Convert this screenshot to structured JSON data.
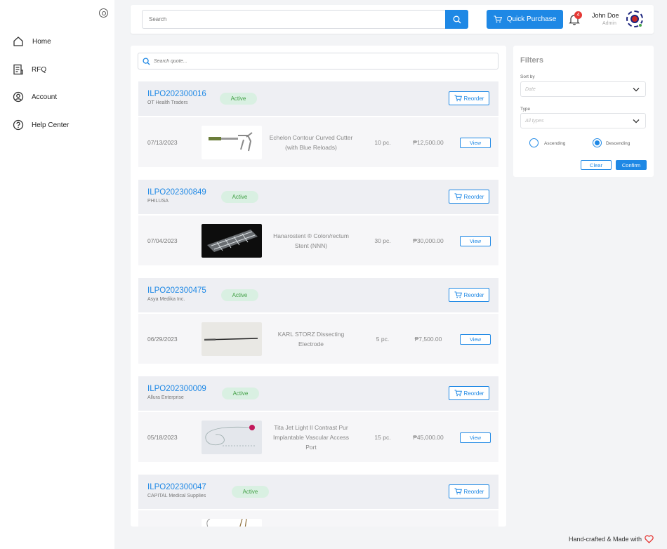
{
  "sidebar": {
    "items": [
      {
        "label": "Home",
        "icon": "home-icon"
      },
      {
        "label": "RFQ",
        "icon": "document-list-icon"
      },
      {
        "label": "Account",
        "icon": "user-circle-icon"
      },
      {
        "label": "Help Center",
        "icon": "help-circle-icon"
      }
    ]
  },
  "topbar": {
    "search_placeholder": "Search",
    "quick_purchase_label": "Quick Purchase",
    "notification_count": "4",
    "user_name": "John Doe",
    "user_role": "Admin"
  },
  "quotes": {
    "search_placeholder": "Search quote...",
    "reorder_label": "Reorder",
    "view_label": "View",
    "items": [
      {
        "code": "ILPO202300016",
        "supplier": "OT Health Traders",
        "status": "Active",
        "date": "07/13/2023",
        "product": "Echelon Contour Curved Cutter (with Blue Reloads)",
        "qty": "10 pc.",
        "price": "₱12,500.00"
      },
      {
        "code": "ILPO202300849",
        "supplier": "PHILUSA",
        "status": "Active",
        "date": "07/04/2023",
        "product": "Hanarostent ® Colon/rectum Stent (NNN)",
        "qty": "30 pc.",
        "price": "₱30,000.00"
      },
      {
        "code": "ILPO202300475",
        "supplier": "Asya Medika Inc.",
        "status": "Active",
        "date": "06/29/2023",
        "product": "KARL STORZ Dissecting Electrode",
        "qty": "5 pc.",
        "price": "₱7,500.00"
      },
      {
        "code": "ILPO202300009",
        "supplier": "Allura Enterprise",
        "status": "Active",
        "date": "05/18/2023",
        "product": "Tita Jet Light II Contrast Pur Implantable Vascular Access Port",
        "qty": "15 pc.",
        "price": "₱45,000.00"
      },
      {
        "code": "ILPO202300047",
        "supplier": "CAPITAL Medical Supplies",
        "status": "Active",
        "date": "",
        "product": "",
        "qty": "",
        "price": ""
      }
    ]
  },
  "filters": {
    "title": "Filters",
    "sort_by_label": "Sort by",
    "sort_by_placeholder": "Date",
    "type_label": "Type",
    "type_placeholder": "All types",
    "ascending_label": "Ascending",
    "descending_label": "Descending",
    "selected_order": "Descending",
    "clear_label": "Clear",
    "confirm_label": "Confirm"
  },
  "footer": {
    "text": "Hand-crafted & Made with"
  },
  "colors": {
    "accent": "#1e88e5",
    "active_badge_bg": "#d9f0e2",
    "active_badge_text": "#43a047"
  }
}
